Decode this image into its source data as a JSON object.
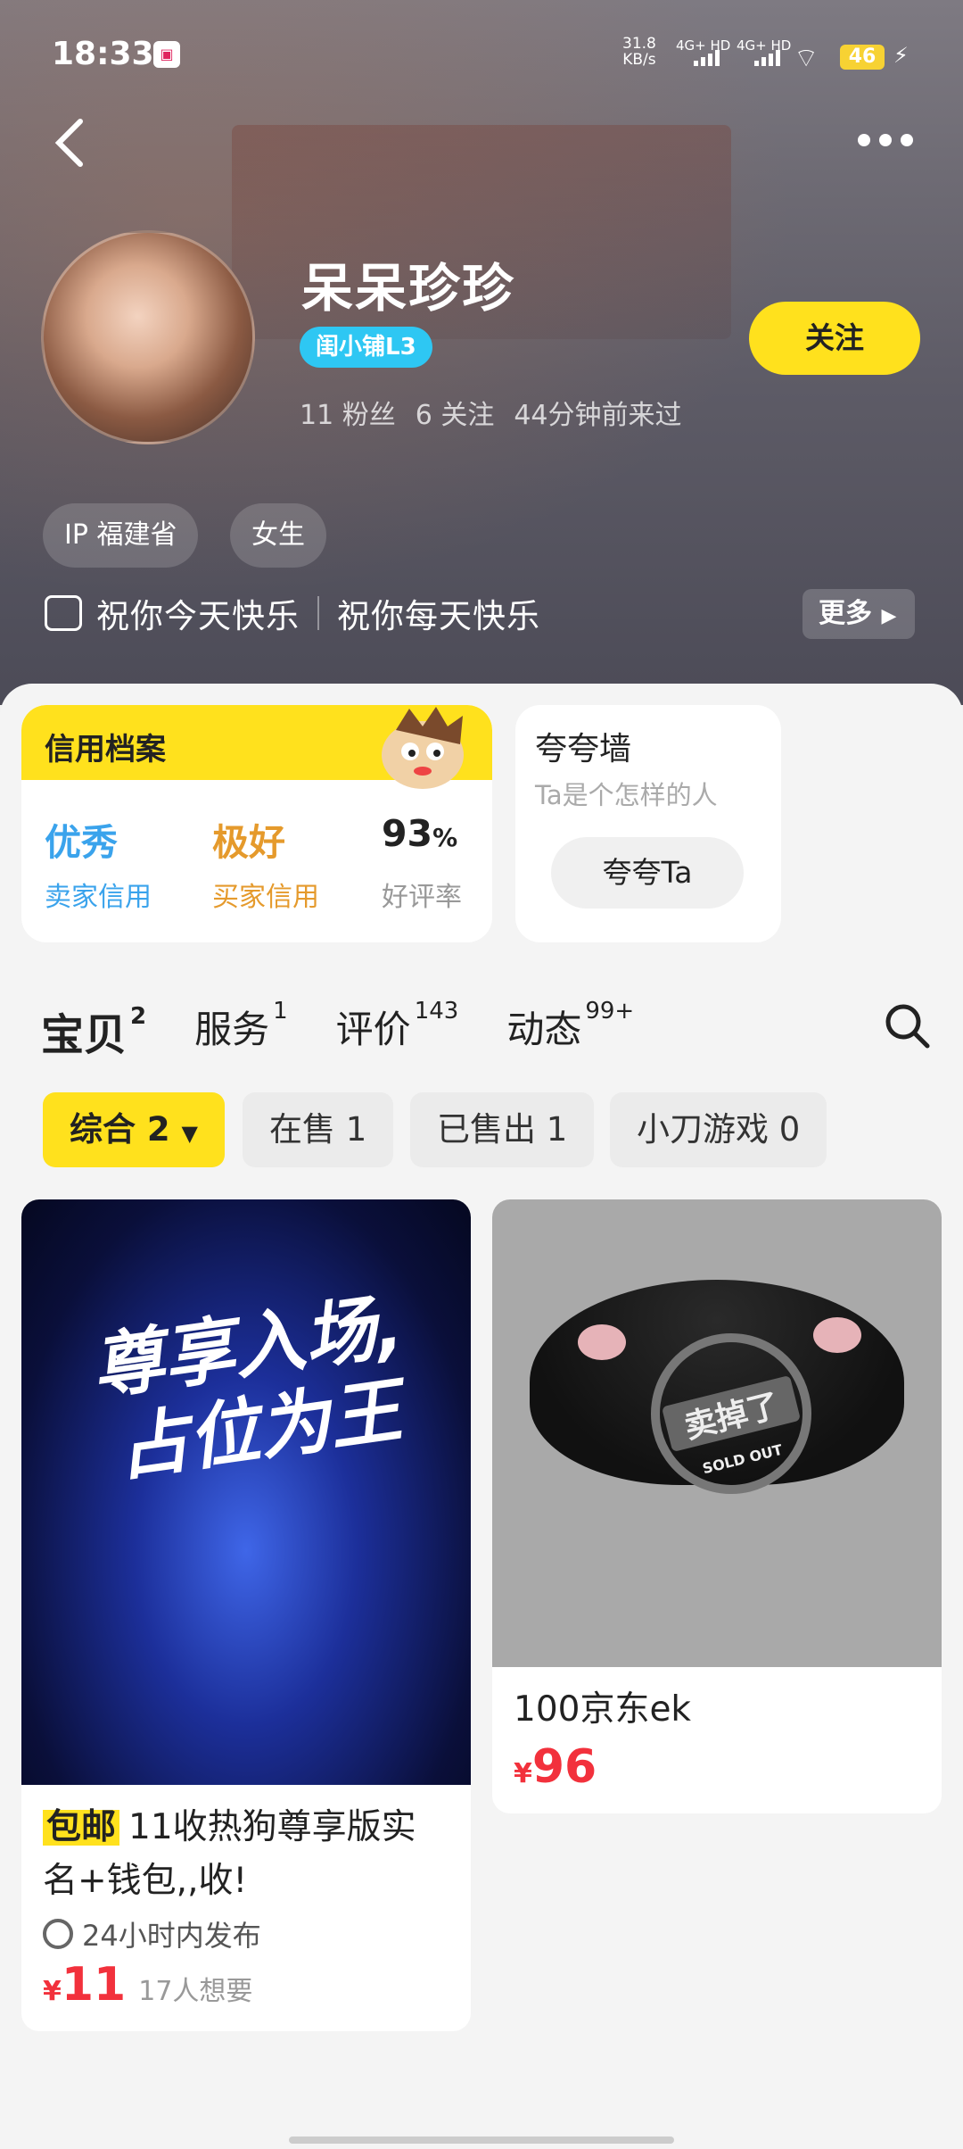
{
  "status_bar": {
    "time": "18:33",
    "speed_value": "31.8",
    "speed_unit": "KB/s",
    "sig1": "4G+ HD",
    "sig2": "4G+ HD",
    "battery": "46"
  },
  "profile": {
    "name": "呆呆珍珍",
    "level_badge": "闺小铺L3",
    "fans": "11 粉丝",
    "following": "6 关注",
    "last_seen": "44分钟前来过",
    "follow_label": "关注",
    "tags": [
      "IP 福建省",
      "女生"
    ],
    "intro1": "祝你今天快乐",
    "intro2": "祝你每天快乐",
    "more_label": "更多"
  },
  "credit": {
    "title": "信用档案",
    "seller_value": "优秀",
    "seller_label": "卖家信用",
    "buyer_value": "极好",
    "buyer_label": "买家信用",
    "rate_value": "93",
    "rate_unit": "%",
    "rate_label": "好评率"
  },
  "praise": {
    "title": "夸夸墙",
    "subtitle": "Ta是个怎样的人",
    "button": "夸夸Ta"
  },
  "tabs": [
    {
      "label": "宝贝",
      "count": "2"
    },
    {
      "label": "服务",
      "count": "1"
    },
    {
      "label": "评价",
      "count": "143"
    },
    {
      "label": "动态",
      "count": "99+"
    }
  ],
  "filters": [
    "综合 2",
    "在售 1",
    "已售出 1",
    "小刀游戏 0"
  ],
  "items": [
    {
      "banner": "尊享入场,占位为王",
      "tag": "包邮",
      "title": "11收热狗尊享版实名+钱包,,收!",
      "publish": "24小时内发布",
      "currency": "¥",
      "price": "11",
      "wants": "17人想要"
    },
    {
      "stamp": "卖掉了",
      "stamp_sub": "SOLD OUT",
      "title": "100京东ek",
      "currency": "¥",
      "price": "96"
    }
  ]
}
